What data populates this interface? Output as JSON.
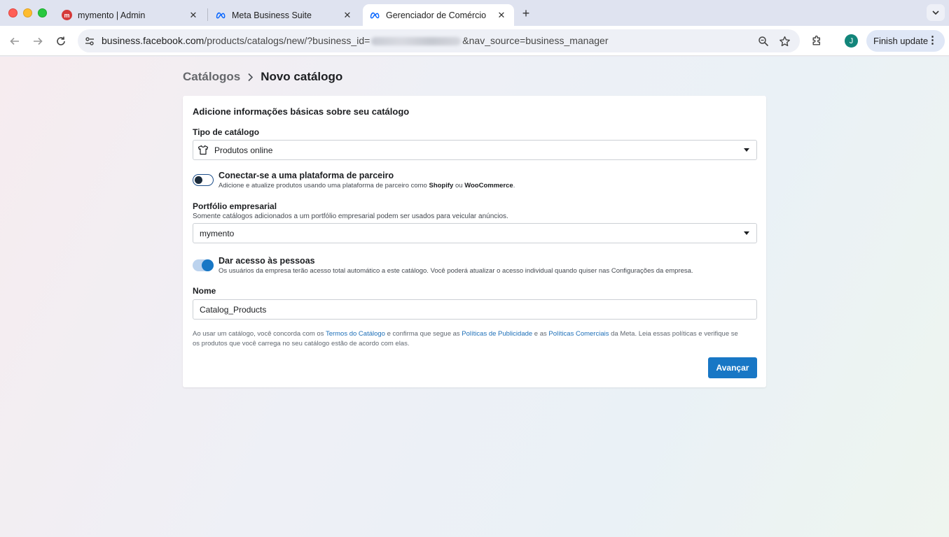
{
  "tabs": [
    {
      "title": "mymento | Admin",
      "favicon": "mymento-icon",
      "active": false
    },
    {
      "title": "Meta Business Suite",
      "favicon": "meta-icon",
      "active": false
    },
    {
      "title": "Gerenciador de Comércio",
      "favicon": "meta-icon",
      "active": true
    }
  ],
  "address_bar": {
    "host": "business.facebook.com",
    "path_before": "/products/catalogs/new/?business_id=",
    "path_after": "&nav_source=business_manager"
  },
  "toolbar": {
    "avatar_initial": "J",
    "finish_update_label": "Finish update"
  },
  "breadcrumb": {
    "parent": "Catálogos",
    "current": "Novo catálogo"
  },
  "form": {
    "title": "Adicione informações básicas sobre seu catálogo",
    "catalog_type": {
      "label": "Tipo de catálogo",
      "value": "Produtos online"
    },
    "partner_platform": {
      "title": "Conectar-se a uma plataforma de parceiro",
      "desc_before": "Adicione e atualize produtos usando uma plataforma de parceiro como ",
      "shopify": "Shopify",
      "desc_or": " ou ",
      "woocommerce": "WooCommerce",
      "desc_end": ".",
      "enabled": false
    },
    "business_portfolio": {
      "label": "Portfólio empresarial",
      "help": "Somente catálogos adicionados a um portfólio empresarial podem ser usados para veicular anúncios.",
      "value": "mymento"
    },
    "people_access": {
      "title": "Dar acesso às pessoas",
      "desc": "Os usuários da empresa terão acesso total automático a este catálogo. Você poderá atualizar o acesso individual quando quiser nas Configurações da empresa.",
      "enabled": true
    },
    "name": {
      "label": "Nome",
      "value": "Catalog_Products"
    },
    "terms": {
      "t1": "Ao usar um catálogo, você concorda com os ",
      "link1": "Termos do Catálogo",
      "t2": " e confirma que segue as ",
      "link2": "Políticas de Publicidade",
      "t3": " e as ",
      "link3": "Políticas Comerciais",
      "t4": " da Meta. Leia essas políticas e verifique se os produtos que você carrega no seu catálogo estão de acordo com elas."
    },
    "submit_label": "Avançar"
  },
  "colors": {
    "primary": "#1877c5",
    "link": "#1d6fb8"
  }
}
